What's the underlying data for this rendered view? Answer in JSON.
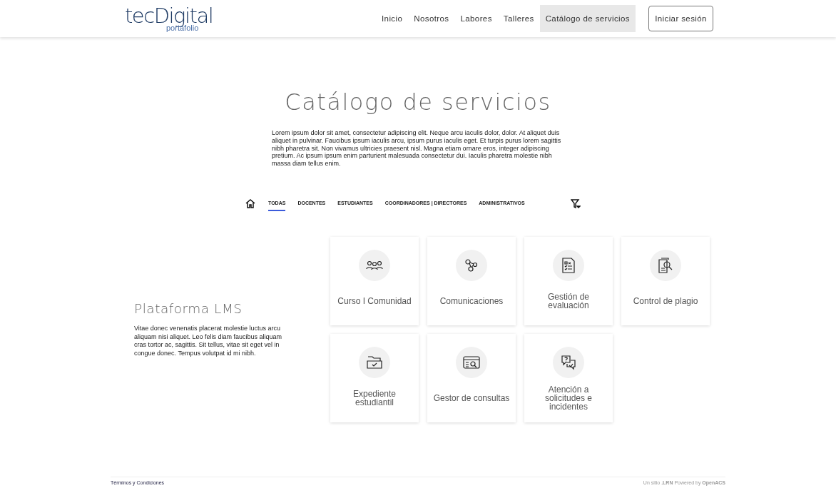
{
  "header": {
    "logo": "tecDigital",
    "logo_sub": "portafolio",
    "nav": [
      {
        "label": "Inicio",
        "selected": false
      },
      {
        "label": "Nosotros",
        "selected": false
      },
      {
        "label": "Labores",
        "selected": false
      },
      {
        "label": "Talleres",
        "selected": false
      },
      {
        "label": "Catálogo de servicios",
        "selected": true
      }
    ],
    "login": "Iniciar sesión"
  },
  "page_title": "Catálogo de servicios",
  "intro": "Lorem ipsum dolor sit amet, consectetur adipiscing elit. Neque arcu iaculis dolor, dolor. At aliquet duis aliquet in pulvinar. Faucibus ipsum iaculis arcu, ipsum purus iaculis eget. Et turpis purus lorem sagittis nibh pharetra sit. Non vivamus ultricies praesent nisl. Magna etiam ornare eros, integer adipiscing pretium. Ac ipsum ipsum enim parturient malesuada consectetur dui. Iaculis pharetra molestie nibh massa diam tellus enim.",
  "filter_tabs": [
    {
      "label": "TODAS",
      "selected": true
    },
    {
      "label": "DOCENTES",
      "selected": false
    },
    {
      "label": "ESTUDIANTES",
      "selected": false
    },
    {
      "label": "COORDINADORES | DIRECTORES",
      "selected": false
    },
    {
      "label": "ADMINISTRATIVOS",
      "selected": false
    }
  ],
  "section": {
    "title": "Plataforma LMS",
    "text": "Vitae donec venenatis placerat molestie luctus arcu aliquam nisi aliquet. Leo felis diam faucibus aliquam cras tortor ac, sagittis. Sit tellus, vitae sit eget vel in congue donec. Tempus volutpat id mi nibh."
  },
  "services": [
    {
      "label": "Curso I Comunidad"
    },
    {
      "label": "Comunicaciones"
    },
    {
      "label": "Gestión de evaluación"
    },
    {
      "label": "Control de plagio"
    },
    {
      "label": "Expediente estudiantil"
    },
    {
      "label": "Gestor de consultas"
    },
    {
      "label": "Atención a solicitudes e incidentes"
    }
  ],
  "footer": {
    "left": "Términos y Condiciones",
    "right": "Un sitio **.LRN** Powered by **OpenACS**"
  }
}
